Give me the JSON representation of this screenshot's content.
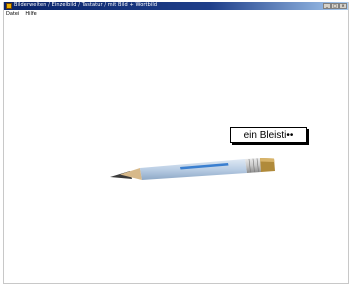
{
  "window": {
    "title": "Bilderwelten / Einzelbild / Tastatur / mit Bild + Wortbild",
    "title_buttons": [
      "_",
      "□",
      "×"
    ]
  },
  "menu": {
    "items": [
      "Datei",
      "Hilfe"
    ]
  },
  "main": {
    "word_label": "ein Bleisti••",
    "image_subject": "pencil"
  },
  "colors": {
    "titlebar_start": "#0a246a",
    "titlebar_end": "#a6caf0",
    "pencil_body": "#b9cde4",
    "pencil_stripe": "#3a7fd0",
    "eraser": "#b08a3a"
  }
}
